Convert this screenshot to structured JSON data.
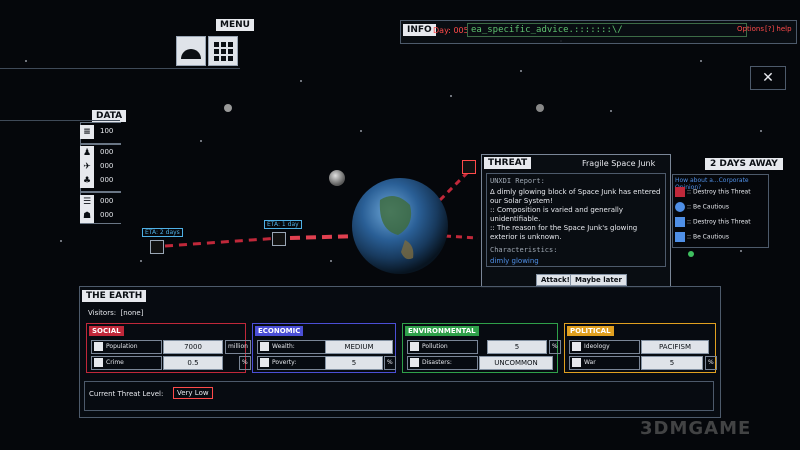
{
  "menu": {
    "label": "MENU"
  },
  "info": {
    "label": "INFO",
    "day": "Day: 005",
    "advice": "ea_specific_advice.:::::::\\/",
    "options": "Options",
    "help": "[?] help"
  },
  "data_panel": {
    "label": "DATA",
    "rows": [
      "100",
      "000",
      "000",
      "000",
      "000",
      "000",
      "000"
    ]
  },
  "close_label": "✕",
  "threat": {
    "label": "THREAT",
    "name": "Fragile Space Junk",
    "eta_label": "2 DAYS AWAY",
    "report_title": "UNXDI Report:",
    "report_lines": [
      "Δ dimly glowing block of Space Junk has entered our Solar System!",
      ":: Composition is varied and generally unidentifiable.",
      ":: The reason for the Space Junk's glowing exterior is unknown."
    ],
    "characteristics_title": "Characteristics:",
    "characteristics": "dimly glowing",
    "attack_label": "Attack!",
    "later_label": "Maybe later"
  },
  "advice_list": {
    "title": "How about a...Corporate Opinion?",
    "items": [
      ":: Destroy this Threat",
      ":: Be Cautious",
      ":: Destroy this Threat",
      ":: Be Cautious"
    ]
  },
  "etas": [
    "ETA: 2 days",
    "ETA: 1 day"
  ],
  "earth": {
    "label": "THE EARTH",
    "visitors_label": "Visitors:",
    "visitors_value": "[none]",
    "social": {
      "label": "SOCIAL",
      "population_label": "Population",
      "population_value": "7000",
      "population_unit": "million",
      "crime_label": "Crime",
      "crime_value": "0.5",
      "crime_unit": "%"
    },
    "economic": {
      "label": "ECONOMIC",
      "wealth_label": "Wealth:",
      "wealth_value": "MEDIUM",
      "poverty_label": "Poverty:",
      "poverty_value": "5",
      "poverty_unit": "%"
    },
    "environmental": {
      "label": "ENVIRONMENTAL",
      "pollution_label": "Pollution",
      "pollution_value": "5",
      "pollution_unit": "%",
      "disasters_label": "Disasters:",
      "disasters_value": "UNCOMMON"
    },
    "political": {
      "label": "POLITICAL",
      "ideology_label": "Ideology",
      "ideology_value": "PACIFISM",
      "war_label": "War",
      "war_value": "5",
      "war_unit": "%"
    },
    "threat_level_label": "Current Threat Level:",
    "threat_level_value": "Very Low"
  },
  "colors": {
    "social": "#c0283a",
    "economic": "#4b4fd6",
    "environmental": "#2fa04a",
    "political": "#e0a020",
    "accent_red": "#ff4a4a",
    "accent_blue": "#4f8fe6"
  },
  "watermark": "3DMGAME"
}
